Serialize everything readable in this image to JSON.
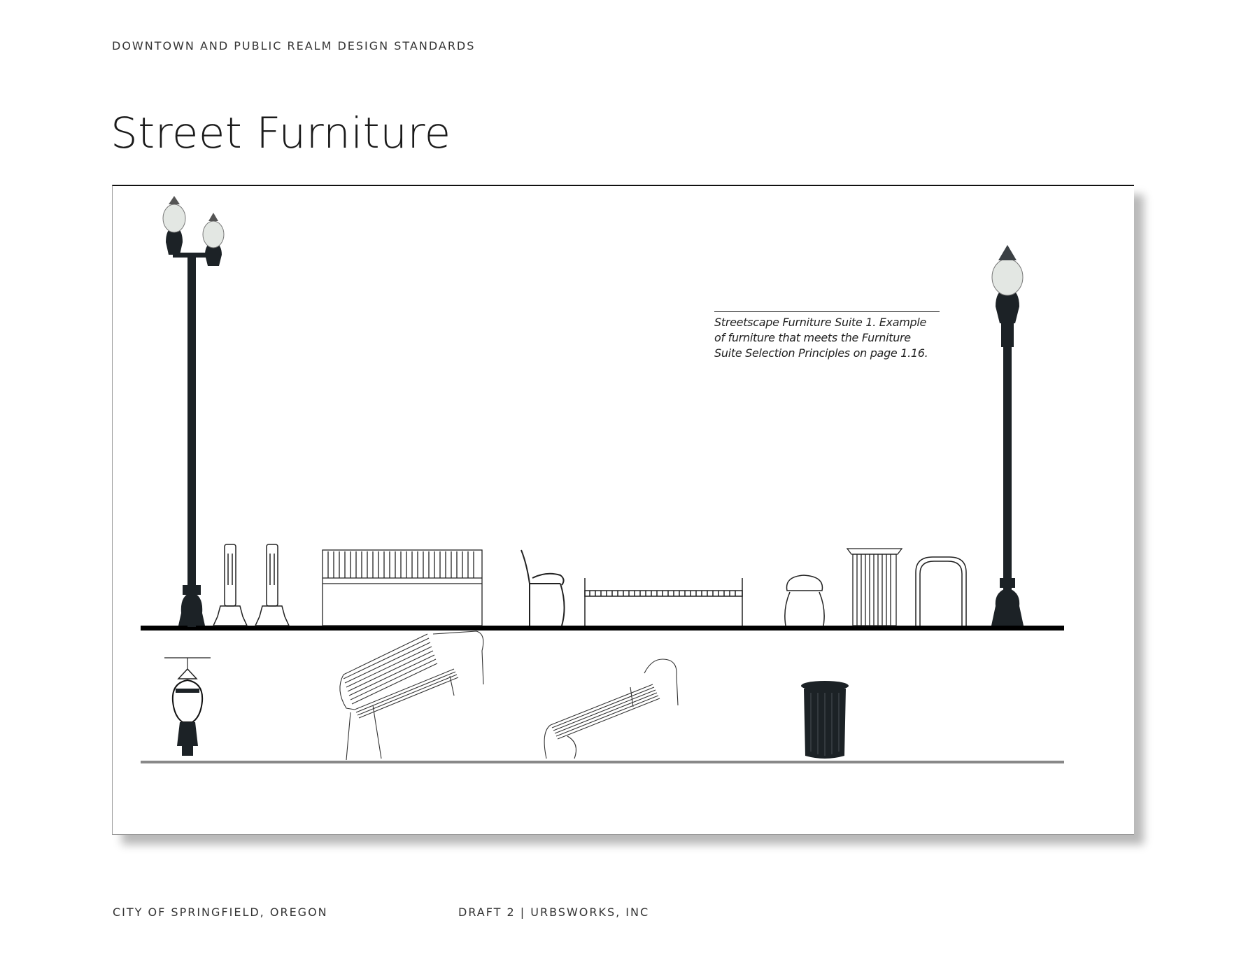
{
  "header": {
    "running_title": "DOWNTOWN AND PUBLIC REALM DESIGN STANDARDS"
  },
  "page": {
    "title": "Street Furniture"
  },
  "figure": {
    "caption": "Streetscape Furniture Suite 1.  Example of furniture that meets the Furniture Suite Selection Principles on page 1.16.",
    "colors": {
      "frame": "#111111",
      "ground": "#000000",
      "fixture": "#1c2226",
      "globe": "#e8ebe8"
    },
    "items_elevation": [
      "double-lamp-post-icon",
      "bollard-icon",
      "bollard-icon",
      "bench-front-icon",
      "chair-side-icon",
      "backless-bench-icon",
      "stool-icon",
      "trash-receptacle-icon",
      "bike-rack-icon",
      "single-lamp-post-icon"
    ],
    "items_perspective": [
      "luminaire-detail-icon",
      "bench-perspective-icon",
      "backless-bench-perspective-icon",
      "trash-can-perspective-icon"
    ]
  },
  "footer": {
    "left": "CITY OF SPRINGFIELD, OREGON",
    "right": "DRAFT 2  |  URBSWORKS, INC"
  }
}
